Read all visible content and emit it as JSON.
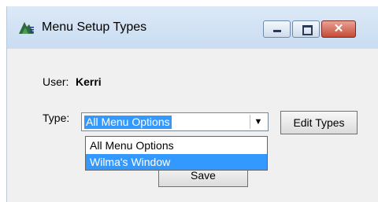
{
  "window": {
    "title": "Menu Setup Types",
    "controls": {
      "minimize_icon": "minimize-icon",
      "maximize_icon": "maximize-icon",
      "close_icon": "close-icon"
    }
  },
  "form": {
    "user_label": "User:",
    "user_value": "Kerri",
    "type_label": "Type:",
    "type_selected": "All Menu Options",
    "type_options": [
      "All Menu Options",
      "Wilma's Window"
    ],
    "highlighted_option": "Wilma's Window",
    "edit_types_label": "Edit Types",
    "save_label": "Save"
  },
  "colors": {
    "selection": "#3399ff",
    "close_button": "#c54b36",
    "titlebar": "#dce9f7"
  }
}
